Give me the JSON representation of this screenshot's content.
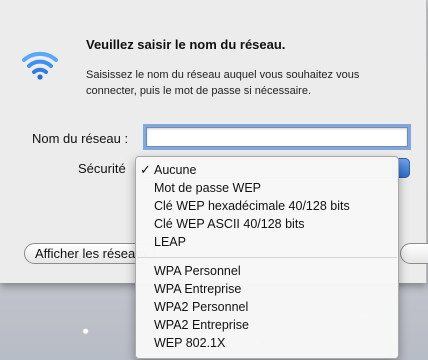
{
  "dialog": {
    "title": "Veuillez saisir le nom du réseau.",
    "description": "Saisissez le nom du réseau auquel vous souhaitez vous connecter, puis le mot de passe si nécessaire.",
    "network_name_label": "Nom du réseau :",
    "network_name_value": "",
    "security_label": "Sécurité",
    "security_selected": "Aucune",
    "other_button_label": "Afficher les réseaux"
  },
  "security_menu": {
    "check_mark": "✓",
    "group1": [
      "Aucune",
      "Mot de passe WEP",
      "Clé WEP hexadécimale 40/128 bits",
      "Clé WEP ASCII 40/128 bits",
      "LEAP"
    ],
    "group2": [
      "WPA Personnel",
      "WPA Entreprise",
      "WPA2 Personnel",
      "WPA2 Entreprise",
      "WEP 802.1X"
    ]
  },
  "colors": {
    "accent": "#3478d6",
    "focus_ring": "#7fa7e0"
  },
  "icons": {
    "wifi": "wifi-icon"
  }
}
